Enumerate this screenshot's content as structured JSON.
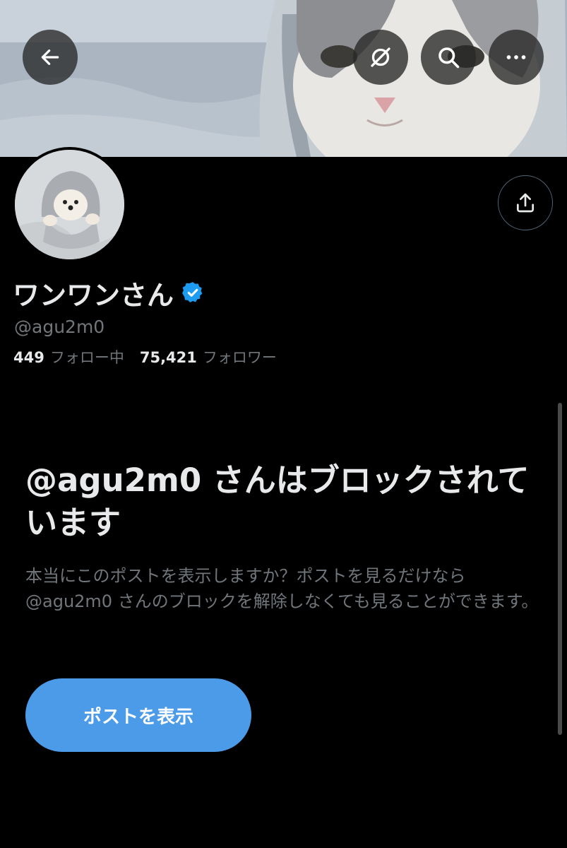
{
  "header": {
    "back_icon": "arrow-left-icon",
    "grok_icon": "grok-icon",
    "search_icon": "search-icon",
    "more_icon": "more-horizontal-icon"
  },
  "profile": {
    "display_name": "ワンワンさん",
    "verified": true,
    "handle": "@agu2m0",
    "following_count": "449",
    "following_label": "フォロー中",
    "followers_count": "75,421",
    "followers_label": "フォロワー",
    "share_icon": "share-icon"
  },
  "blocked_notice": {
    "title": "@agu2m0 さんはブロックされています",
    "description": "本当にこのポストを表示しますか？ポストを見るだけなら @agu2m0 さんのブロックを解除しなくても見ることができます。",
    "button_label": "ポストを表示"
  },
  "colors": {
    "background": "#000000",
    "accent": "#4c9be8",
    "verified": "#1d9bf0",
    "muted_text": "#71767b"
  }
}
